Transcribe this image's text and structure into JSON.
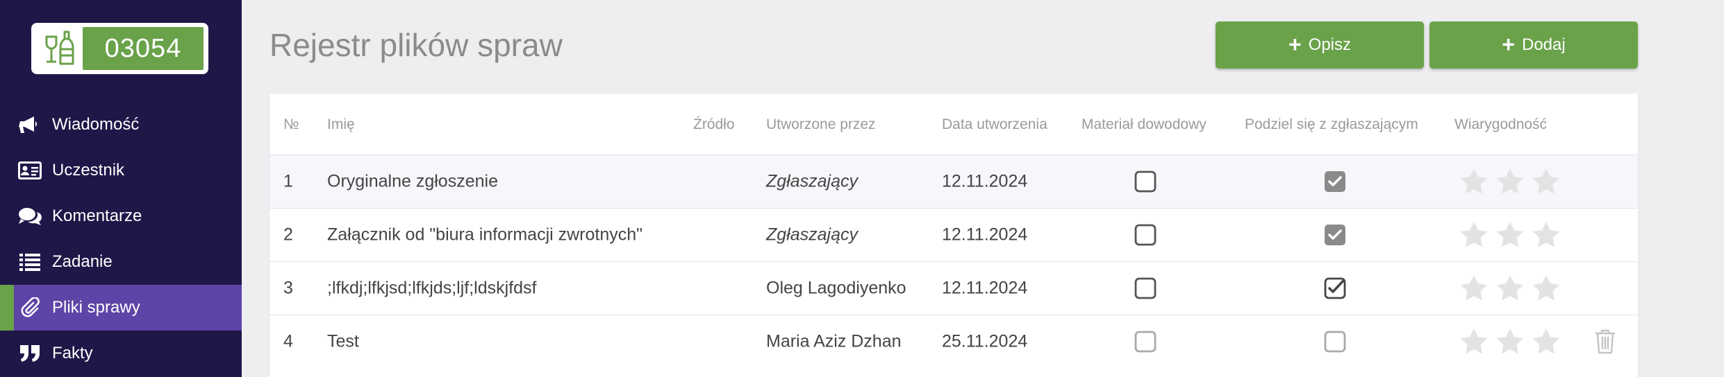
{
  "sidebar": {
    "badge_number": "03054",
    "badge_icon": "wine-bottle-glass-icon",
    "items": [
      {
        "label": "Wiadomość",
        "icon": "megaphone-icon",
        "active": false
      },
      {
        "label": "Uczestnik",
        "icon": "id-card-icon",
        "active": false
      },
      {
        "label": "Komentarze",
        "icon": "comments-icon",
        "active": false
      },
      {
        "label": "Zadanie",
        "icon": "list-icon",
        "active": false
      },
      {
        "label": "Pliki sprawy",
        "icon": "paperclip-icon",
        "active": true
      },
      {
        "label": "Fakty",
        "icon": "quote-icon",
        "active": false
      }
    ]
  },
  "header": {
    "title": "Rejestr plików spraw",
    "btn_opisz": "Opisz",
    "btn_dodaj": "Dodaj"
  },
  "table": {
    "columns": {
      "num": "№",
      "name": "Imię",
      "source": "Źródło",
      "created_by": "Utworzone przez",
      "date": "Data utworzenia",
      "evidence": "Materiał dowodowy",
      "share": "Podziel się z zgłaszającym",
      "credibility": "Wiarygodność"
    },
    "rows": [
      {
        "num": "1",
        "name": "Oryginalne zgłoszenie",
        "created_by": "Zgłaszający",
        "date": "12.11.2024",
        "evidence": false,
        "share": true,
        "share_style": "filled",
        "rating": 0,
        "deletable": false
      },
      {
        "num": "2",
        "name": "Załącznik od \"biura informacji zwrotnych\"",
        "created_by": "Zgłaszający",
        "date": "12.11.2024",
        "evidence": false,
        "share": true,
        "share_style": "filled",
        "rating": 0,
        "deletable": false
      },
      {
        "num": "3",
        "name": ";lfkdj;lfkjsd;lfkjds;ljf;ldskjfdsf",
        "created_by": "Oleg Lagodiyenko",
        "date": "12.11.2024",
        "evidence": false,
        "share": true,
        "share_style": "outline",
        "rating": 0,
        "deletable": false
      },
      {
        "num": "4",
        "name": "Test",
        "created_by": "Maria Aziz Dzhan",
        "date": "25.11.2024",
        "evidence": false,
        "share": false,
        "share_style": "light",
        "rating": 0,
        "deletable": true
      }
    ]
  },
  "colors": {
    "sidebar_bg": "#1f1748",
    "active_item": "#5e44a6",
    "accent_green": "#6aa24a",
    "star_gray": "#e3e3e3"
  }
}
